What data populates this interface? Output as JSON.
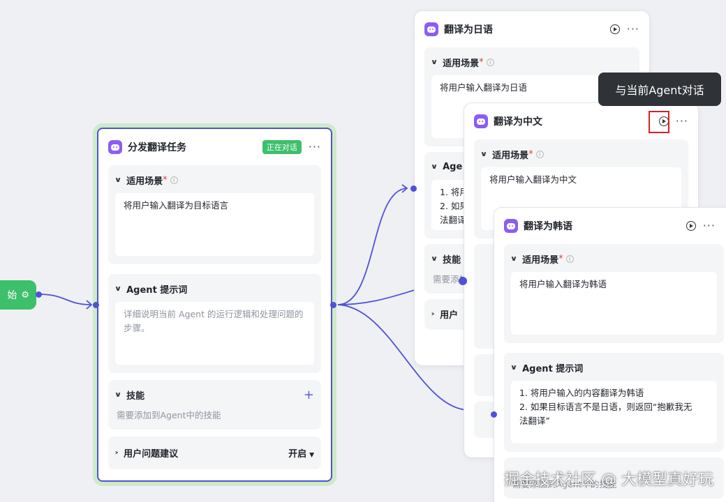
{
  "start_node": {
    "label": "始",
    "icon": "gear-icon"
  },
  "main_card": {
    "title": "分发翻译任务",
    "status_badge": "正在对话",
    "more": "···",
    "scene": {
      "label": "适用场景",
      "required": "*",
      "value": "将用户输入翻译为目标语言"
    },
    "prompt": {
      "label": "Agent 提示词",
      "placeholder": "详细说明当前 Agent 的运行逻辑和处理问题的步骤。"
    },
    "skills": {
      "label": "技能",
      "hint": "需要添加到Agent中的技能",
      "add": "+"
    },
    "suggest": {
      "label": "用户问题建议",
      "toggle": "开启"
    }
  },
  "card_japanese": {
    "title": "翻译为日语",
    "more": "···",
    "scene": {
      "label": "适用场景",
      "required": "*",
      "value": "将用户输入翻译为日语"
    },
    "prompt": {
      "label": "Age",
      "lines": [
        "1. 将用",
        "2. 如果",
        "法翻译"
      ]
    },
    "skills": {
      "label": "技能",
      "hint": "需要添加"
    },
    "suggest": {
      "label": "用户"
    }
  },
  "card_chinese": {
    "title": "翻译为中文",
    "more": "···",
    "scene": {
      "label": "适用场景",
      "required": "*",
      "value": "将用户输入翻译为中文"
    }
  },
  "card_korean": {
    "title": "翻译为韩语",
    "more": "···",
    "scene": {
      "label": "适用场景",
      "required": "*",
      "value": "将用户输入翻译为韩语"
    },
    "prompt": {
      "label": "Agent 提示词",
      "lines": [
        "1. 将用户输入的内容翻译为韩语",
        "2. 如果目标语言不是日语，则返回“抱歉我无",
        "法翻译”"
      ]
    },
    "skills": {
      "hint": "需要添加到Agent中的技能"
    }
  },
  "tooltip": "与当前Agent对话",
  "watermark": "掘金技术社区 @ 大模型真好玩",
  "colors": {
    "accent": "#4f52d6",
    "green": "#3dbf6b",
    "bot": "#8b5cf6"
  }
}
